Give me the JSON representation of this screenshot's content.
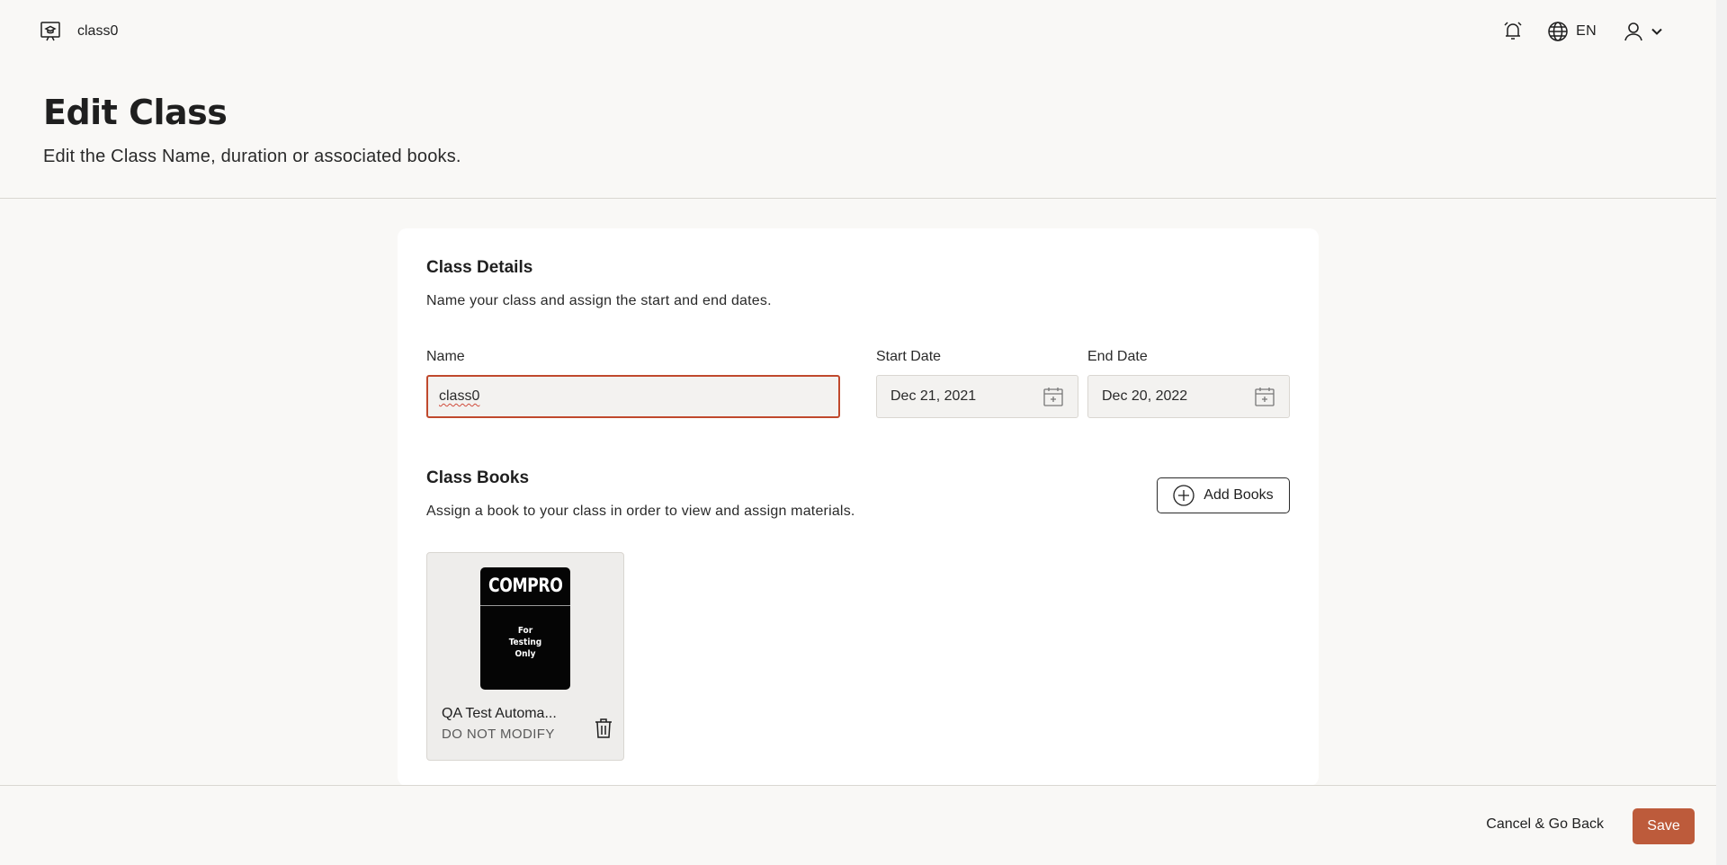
{
  "header": {
    "brand_name": "class0",
    "language": "EN"
  },
  "page": {
    "title": "Edit Class",
    "subtitle": "Edit the Class Name, duration or associated books."
  },
  "details": {
    "title": "Class Details",
    "description": "Name your class and assign the start and end dates.",
    "name_label": "Name",
    "name_value": "class0",
    "start_label": "Start Date",
    "start_value": "Dec 21, 2021",
    "end_label": "End Date",
    "end_value": "Dec 20, 2022"
  },
  "books": {
    "title": "Class Books",
    "description": "Assign a book to your class in order to view and assign materials.",
    "add_label": "Add Books",
    "items": [
      {
        "cover_brand": "COMPRO",
        "cover_note": "For\nTesting\nOnly",
        "title": "QA Test Automa...",
        "subtitle": "DO NOT MODIFY"
      }
    ]
  },
  "footer": {
    "cancel_label": "Cancel & Go Back",
    "save_label": "Save"
  },
  "colors": {
    "accent": "#bd5b3b",
    "error_border": "#c0492d",
    "background": "#f9f8f6"
  }
}
